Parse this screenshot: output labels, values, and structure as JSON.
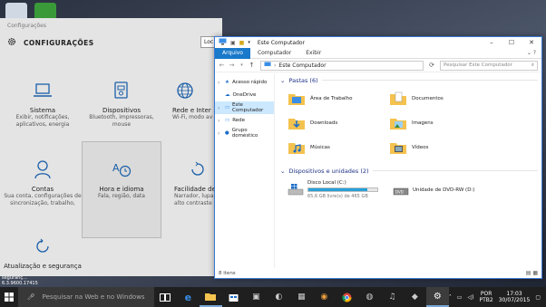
{
  "desktop": {
    "caption": "Atualização seguranç... 6.3.9600.17415"
  },
  "settings": {
    "window_title": "Configurações",
    "header": "CONFIGURAÇÕES",
    "search_placeholder": "Loc",
    "tiles": [
      {
        "name": "Sistema",
        "desc": "Exibir, notificações, aplicativos, energia",
        "icon": "laptop-icon"
      },
      {
        "name": "Dispositivos",
        "desc": "Bluetooth, impressoras, mouse",
        "icon": "devices-icon"
      },
      {
        "name": "Rede e Inter",
        "desc": "Wi-Fi, modo av",
        "icon": "globe-icon"
      },
      {
        "name": "Contas",
        "desc": "Sua conta, configurações de sincronização, trabalho,",
        "icon": "person-icon"
      },
      {
        "name": "Hora e idioma",
        "desc": "Fala, região, data",
        "icon": "time-language-icon"
      },
      {
        "name": "Facilidade de A",
        "desc": "Narrador, lupa, alto contraste",
        "icon": "ease-of-access-icon"
      },
      {
        "name": "Atualização e segurança",
        "desc": "",
        "icon": "update-icon"
      }
    ]
  },
  "explorer": {
    "title": "Este Computador",
    "ribbon_tabs": [
      "Arquivo",
      "Computador",
      "Exibir"
    ],
    "path": "Este Computador",
    "search_placeholder": "Pesquisar Este Computador",
    "nav": [
      {
        "label": "Acesso rápido",
        "icon": "star-icon"
      },
      {
        "label": "OneDrive",
        "icon": "cloud-icon"
      },
      {
        "label": "Este Computador",
        "icon": "pc-icon"
      },
      {
        "label": "Rede",
        "icon": "network-icon"
      },
      {
        "label": "Grupo doméstico",
        "icon": "homegroup-icon"
      }
    ],
    "folders_header": "Pastas (6)",
    "folders": [
      "Área de Trabalho",
      "Documentos",
      "Downloads",
      "Imagens",
      "Músicas",
      "Vídeos"
    ],
    "devices_header": "Dispositivos e unidades (2)",
    "drives": [
      {
        "name": "Disco Local (C:)",
        "free": "65,6 GB livre(s) de 465 GB",
        "used_fraction": 0.86
      },
      {
        "name": "Unidade de DVD-RW (D:)"
      }
    ],
    "status": "8 itens"
  },
  "taskbar": {
    "search_placeholder": "Pesquisar na Web e no Windows",
    "language": "POR",
    "layout": "PTB2",
    "time": "17:03",
    "date": "30/07/2015"
  }
}
